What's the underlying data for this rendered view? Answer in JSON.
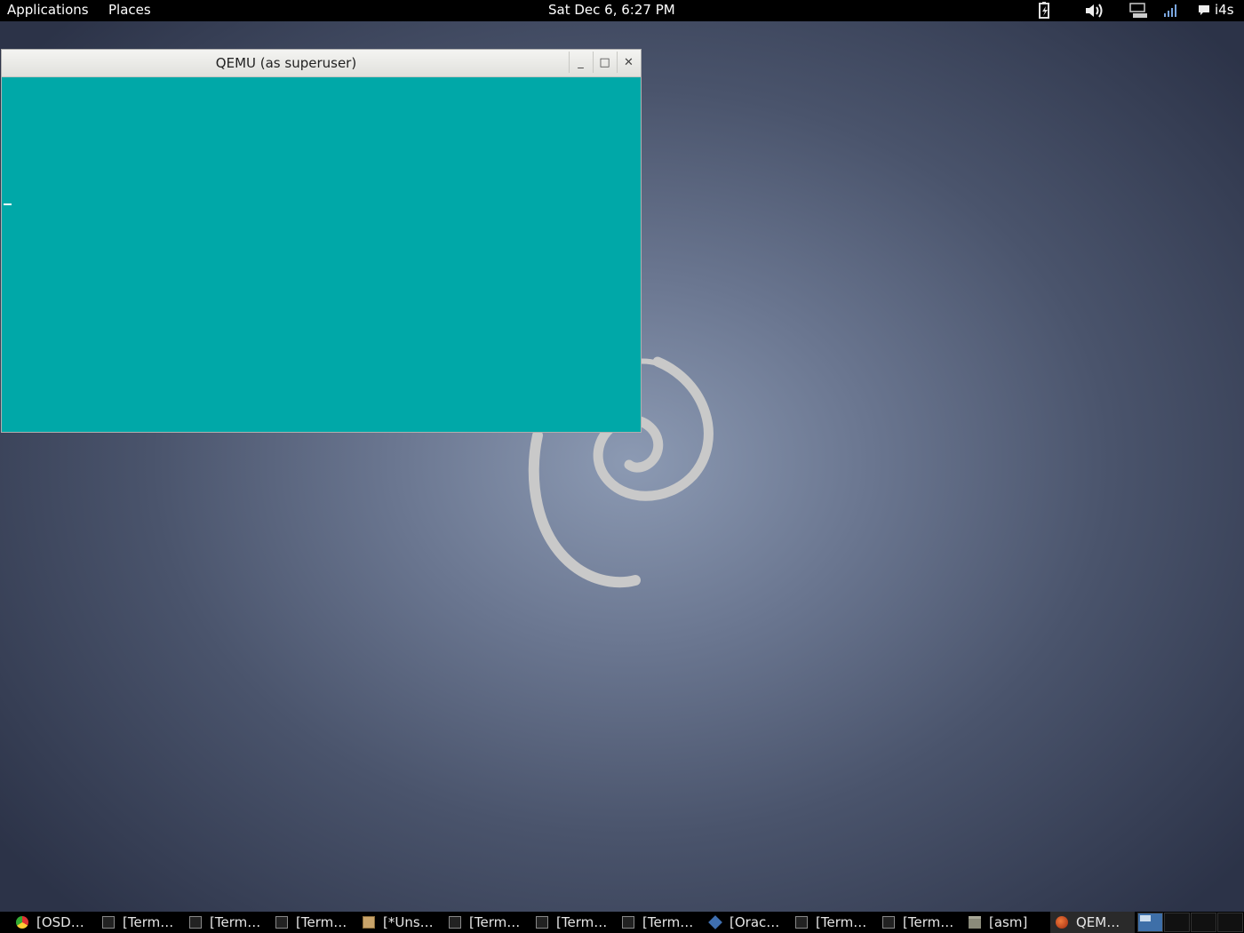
{
  "top_panel": {
    "menu_applications": "Applications",
    "menu_places": "Places",
    "clock": "Sat Dec  6,  6:27 PM",
    "user": "i4s",
    "tray_icons": [
      "battery-icon",
      "volume-icon",
      "network-icon",
      "signal-icon",
      "chat-icon"
    ]
  },
  "qemu_window": {
    "title": "QEMU (as superuser)",
    "minimize_symbol": "_",
    "maximize_symbol": "□",
    "close_symbol": "✕",
    "screen_color": "#00a8a8"
  },
  "taskbar": {
    "tasks": [
      {
        "label": "[OSD…",
        "icon": "chrome-icon"
      },
      {
        "label": "[Term…",
        "icon": "terminal-icon"
      },
      {
        "label": "[Term…",
        "icon": "terminal-icon"
      },
      {
        "label": "[Term…",
        "icon": "terminal-icon"
      },
      {
        "label": "[*Uns…",
        "icon": "text-editor-icon"
      },
      {
        "label": "[Term…",
        "icon": "terminal-icon"
      },
      {
        "label": "[Term…",
        "icon": "terminal-icon"
      },
      {
        "label": "[Term…",
        "icon": "terminal-icon"
      },
      {
        "label": "[Orac…",
        "icon": "virtualbox-icon"
      },
      {
        "label": "[Term…",
        "icon": "terminal-icon"
      },
      {
        "label": "[Term…",
        "icon": "terminal-icon"
      },
      {
        "label": "[asm]",
        "icon": "folder-icon"
      },
      {
        "label": "QEM…",
        "icon": "qemu-icon"
      }
    ],
    "active_workspace": 1,
    "workspace_count": 4
  }
}
